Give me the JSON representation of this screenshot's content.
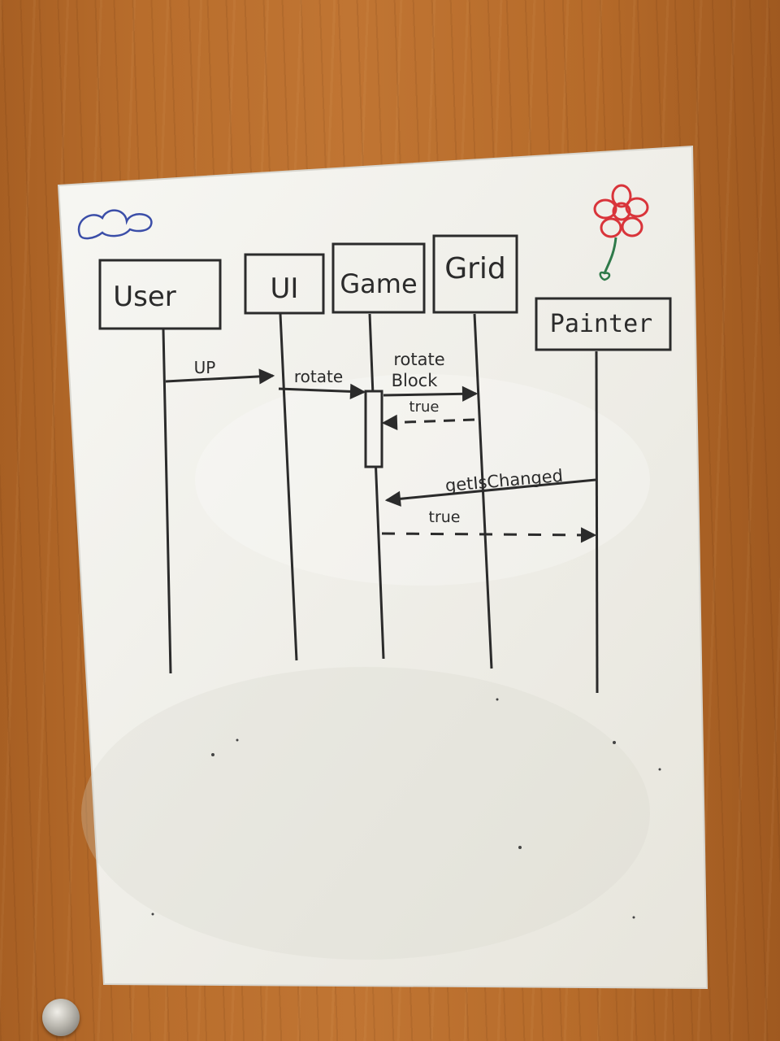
{
  "diagram": {
    "participants": [
      {
        "id": "user",
        "label": "User"
      },
      {
        "id": "ui",
        "label": "UI"
      },
      {
        "id": "game",
        "label": "Game"
      },
      {
        "id": "grid",
        "label": "Grid"
      },
      {
        "id": "painter",
        "label": "Painter"
      }
    ],
    "messages": [
      {
        "id": "m1",
        "from": "user",
        "to": "ui",
        "label": "UP",
        "style": "solid"
      },
      {
        "id": "m2",
        "from": "ui",
        "to": "game",
        "label": "rotate",
        "style": "solid"
      },
      {
        "id": "m3",
        "from": "game",
        "to": "grid",
        "label": "rotate",
        "label2": "Block",
        "style": "solid"
      },
      {
        "id": "m4",
        "from": "grid",
        "to": "game",
        "label": "true",
        "style": "dashed"
      },
      {
        "id": "m5",
        "from": "painter",
        "to": "game",
        "label": "getIsChanged",
        "style": "solid"
      },
      {
        "id": "m6",
        "from": "game",
        "to": "painter",
        "label": "true",
        "style": "dashed"
      }
    ]
  },
  "decorations": {
    "cloud_color": "#3b4ea8",
    "flower_petal_color": "#d9343a",
    "flower_stem_color": "#2f7a4a",
    "marker_color": "#2b2b2b",
    "paper_color": "#f4f3ef"
  }
}
